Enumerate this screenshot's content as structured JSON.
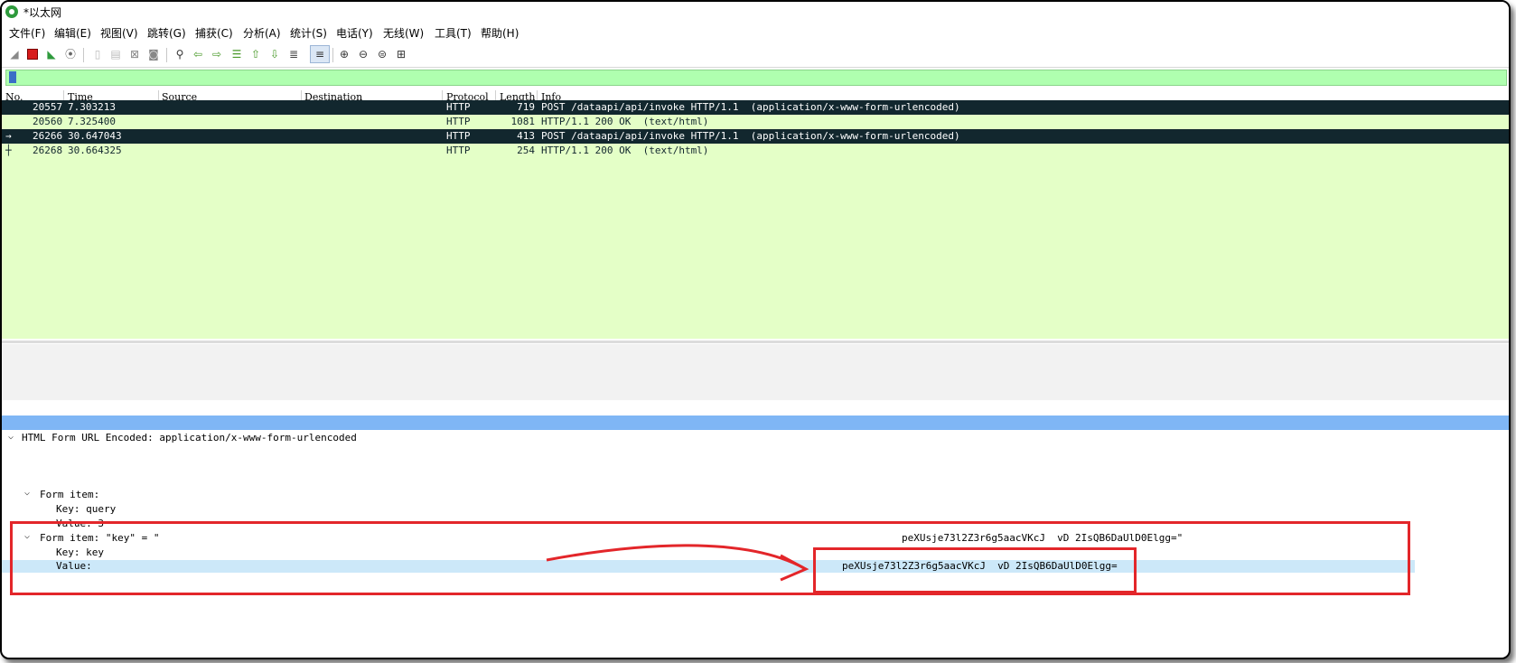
{
  "window": {
    "title": "*以太网"
  },
  "menu": [
    "文件(F)",
    "编辑(E)",
    "视图(V)",
    "跳转(G)",
    "捕获(C)",
    "分析(A)",
    "统计(S)",
    "电话(Y)",
    "无线(W)",
    "工具(T)",
    "帮助(H)"
  ],
  "toolbar": {
    "icons": [
      "shark-fin-start-icon",
      "stop-capture-icon",
      "restart-capture-icon",
      "capture-options-icon",
      "open-file-icon",
      "save-file-icon",
      "close-file-icon",
      "reload-file-icon",
      "find-packet-icon",
      "go-back-icon",
      "go-forward-icon",
      "go-to-packet-icon",
      "go-first-icon",
      "go-last-icon",
      "autoscroll-icon",
      "colorize-icon",
      "zoom-in-icon",
      "zoom-out-icon",
      "zoom-normal-icon",
      "resize-columns-icon"
    ]
  },
  "filter": {
    "value": "",
    "background": "#afffaf"
  },
  "packet_list": {
    "columns": [
      "No.",
      "Time",
      "Source",
      "Destination",
      "Protocol",
      "Length",
      "Info"
    ],
    "rows": [
      {
        "no": "20557",
        "time": "7.303213",
        "source": "",
        "destination": "",
        "protocol": "HTTP",
        "length": "719",
        "info": "POST /dataapi/api/invoke HTTP/1.1  (application/x-www-form-urlencoded)",
        "selected": true,
        "mark": ""
      },
      {
        "no": "20560",
        "time": "7.325400",
        "source": "",
        "destination": "",
        "protocol": "HTTP",
        "length": "1081",
        "info": "HTTP/1.1 200 OK  (text/html)",
        "selected": false,
        "mark": ""
      },
      {
        "no": "26266",
        "time": "30.647043",
        "source": "",
        "destination": "",
        "protocol": "HTTP",
        "length": "413",
        "info": "POST /dataapi/api/invoke HTTP/1.1  (application/x-www-form-urlencoded)",
        "selected": true,
        "mark": "→"
      },
      {
        "no": "26268",
        "time": "30.664325",
        "source": "",
        "destination": "",
        "protocol": "HTTP",
        "length": "254",
        "info": "HTTP/1.1 200 OK  (text/html)",
        "selected": false,
        "mark": "┼"
      }
    ],
    "selected_color": "#12272e",
    "row_color": "#e4ffc7"
  },
  "details": {
    "root": "HTML Form URL Encoded: application/x-www-form-urlencoded",
    "item1": {
      "header": "Form item:",
      "key": "Key: query",
      "value": "Value: 3"
    },
    "item2": {
      "header": "Form item: \"key\" = \"",
      "header_value": "peXUsje73l2Z3r6g5aacVKcJ  vD 2IsQB6DaUlD0Elgg=\"",
      "key": "Key: key",
      "value_label": "Value:",
      "value": "peXUsje73l2Z3r6g5aacVKcJ  vD 2IsQB6DaUlD0Elgg="
    }
  },
  "colors": {
    "annotation": "#e3262a",
    "detail_band": "#7fb6f5",
    "value_highlight": "#cce8f9"
  }
}
